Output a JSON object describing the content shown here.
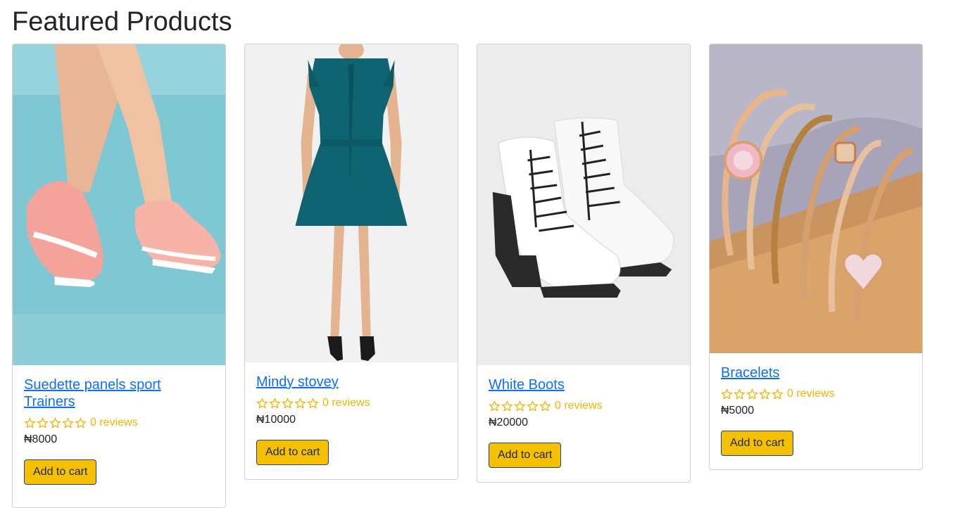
{
  "page": {
    "title": "Featured Products"
  },
  "colors": {
    "link": "#0d6efd",
    "star": "#f0b400",
    "button": "#f5c000",
    "button_border": "#1f3f8f"
  },
  "products": [
    {
      "name": "Suedette panels sport Trainers",
      "reviews": "0 reviews",
      "price": "₦8000",
      "button": "Add to cart",
      "image": "pink-sneakers-image",
      "rating": 0
    },
    {
      "name": "Mindy stovey",
      "reviews": "0 reviews",
      "price": "₦10000",
      "button": "Add to cart",
      "image": "teal-dress-image",
      "rating": 0
    },
    {
      "name": "White Boots",
      "reviews": "0 reviews",
      "price": "₦20000",
      "button": "Add to cart",
      "image": "white-boots-image",
      "rating": 0
    },
    {
      "name": "Bracelets",
      "reviews": "0 reviews",
      "price": "₦5000",
      "button": "Add to cart",
      "image": "bracelets-image",
      "rating": 0
    }
  ]
}
